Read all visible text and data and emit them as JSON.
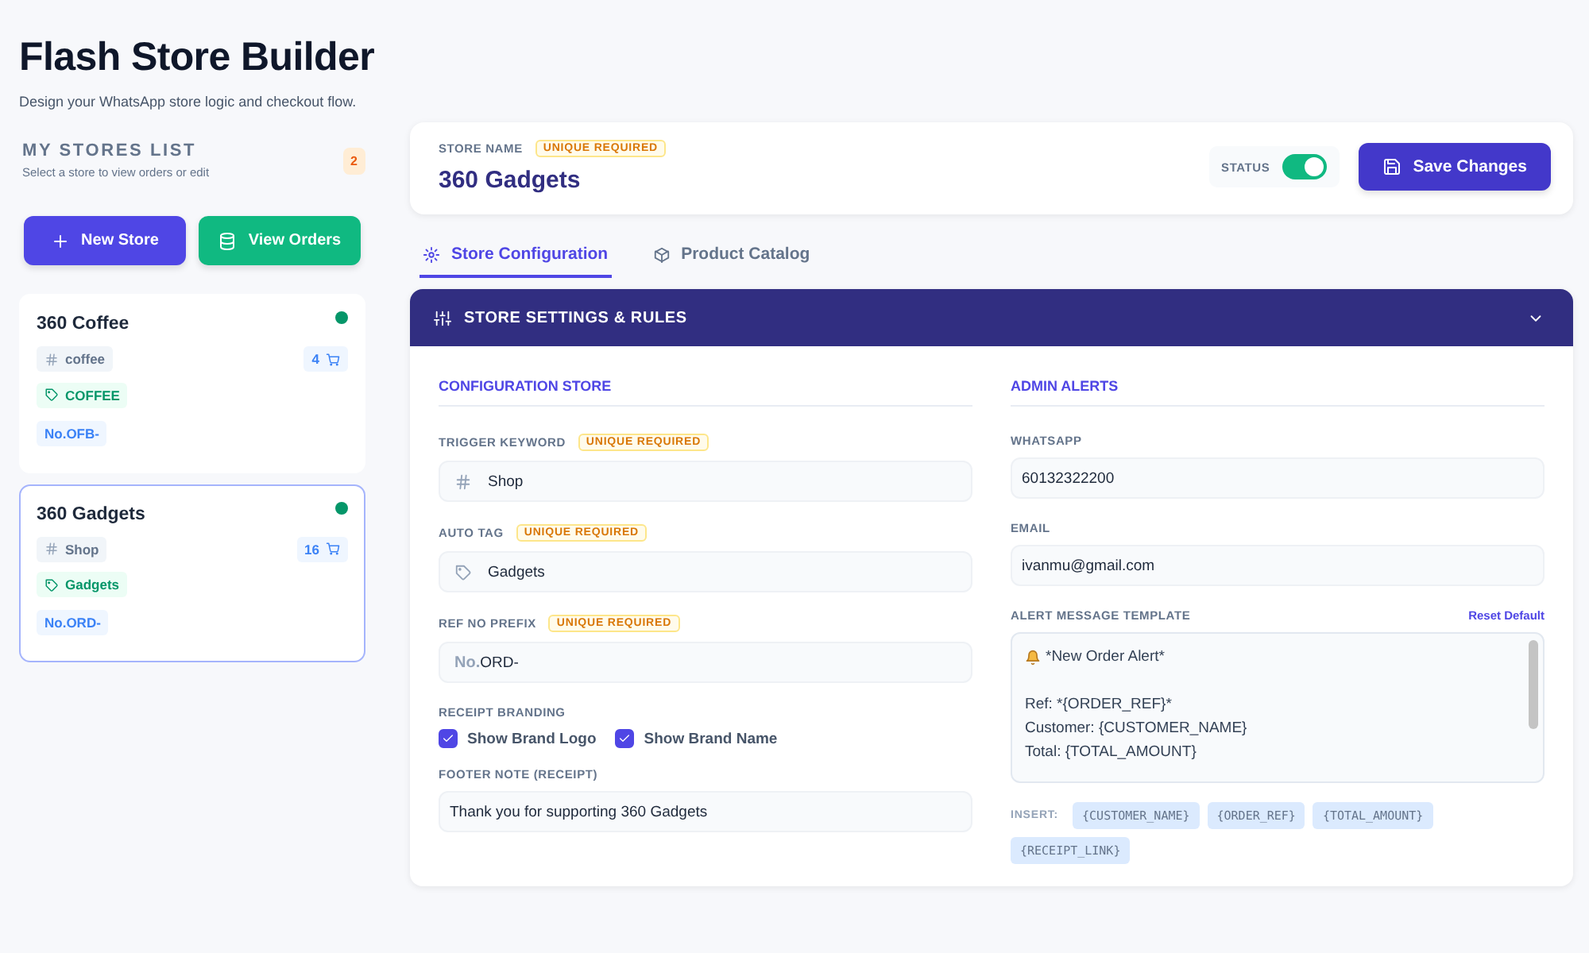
{
  "header": {
    "title": "Flash Store Builder",
    "subtitle": "Design your WhatsApp store logic and checkout flow."
  },
  "sidebar": {
    "title": "MY STORES LIST",
    "subtitle": "Select a store to view orders or edit",
    "count": "2",
    "buttons": [
      {
        "label": "New Store",
        "kind": "add"
      },
      {
        "label": "View Orders",
        "kind": "orders"
      }
    ],
    "stores": [
      {
        "name": "360 Coffee",
        "keyword": "coffee",
        "orders": "4",
        "tag": "COFFEE",
        "prefix": "No.OFB-",
        "active": true,
        "selected": false
      },
      {
        "name": "360 Gadgets",
        "keyword": "Shop",
        "orders": "16",
        "tag": "Gadgets",
        "prefix": "No.ORD-",
        "active": true,
        "selected": true
      }
    ]
  },
  "store_header": {
    "label": "STORE NAME",
    "badge": "UNIQUE REQUIRED",
    "name": "360 Gadgets",
    "status_label": "STATUS",
    "status_on": true,
    "save_button": "Save Changes"
  },
  "tabs": [
    {
      "label": "Store Configuration",
      "kind": "gear",
      "selected": true
    },
    {
      "label": "Product Catalog",
      "kind": "box",
      "selected": false
    }
  ],
  "settings": {
    "title": "STORE SETTINGS & RULES",
    "expanded": true,
    "config": {
      "title": "CONFIGURATION STORE",
      "fields": [
        {
          "label": "TRIGGER KEYWORD",
          "badge": "UNIQUE REQUIRED",
          "kind": "hash",
          "value": "Shop"
        },
        {
          "label": "AUTO TAG",
          "badge": "UNIQUE REQUIRED",
          "kind": "tag",
          "value": "Gadgets"
        },
        {
          "label": "REF NO PREFIX",
          "badge": "UNIQUE REQUIRED",
          "kind": "prefix",
          "prefix": "No.",
          "value": "ORD-"
        }
      ],
      "branding_label": "RECEIPT BRANDING",
      "checkboxes": [
        {
          "label": "Show Brand Logo",
          "checked": true
        },
        {
          "label": "Show Brand Name",
          "checked": true
        }
      ],
      "footer_label": "FOOTER NOTE (RECEIPT)",
      "footer_value": "Thank you for supporting 360 Gadgets"
    },
    "alerts": {
      "title": "ADMIN ALERTS",
      "fields": [
        {
          "label": "WHATSAPP",
          "value": "60132322200"
        },
        {
          "label": "EMAIL",
          "value": "ivanmu@gmail.com"
        }
      ],
      "template_label": "ALERT MESSAGE TEMPLATE",
      "reset_link": "Reset Default",
      "template_lines": [
        "*New Order Alert*",
        "Ref: *{ORDER_REF}*",
        "Customer: {CUSTOMER_NAME}",
        "Total: {TOTAL_AMOUNT}"
      ],
      "insert_label": "INSERT:",
      "variables": [
        "{CUSTOMER_NAME}",
        "{ORDER_REF}",
        "{TOTAL_AMOUNT}",
        "{RECEIPT_LINK}"
      ]
    }
  }
}
